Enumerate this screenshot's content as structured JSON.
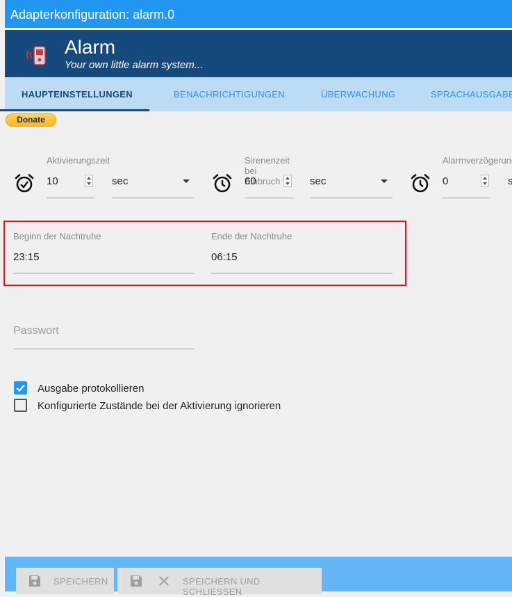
{
  "window": {
    "title": "Adapterkonfiguration: alarm.0"
  },
  "header": {
    "title": "Alarm",
    "subtitle": "Your own little alarm system..."
  },
  "tabs": [
    {
      "label": "HAUPTEINSTELLUNGEN",
      "active": true
    },
    {
      "label": "BENACHRICHTIGUNGEN",
      "active": false
    },
    {
      "label": "ÜBERWACHUNG",
      "active": false
    },
    {
      "label": "SPRACHAUSGABE",
      "active": false
    }
  ],
  "donate": {
    "label": "Donate"
  },
  "timers": [
    {
      "label": "Aktivierungszeit",
      "value": "10",
      "unit": "sec",
      "icon": "alarm-check-icon"
    },
    {
      "label": "Sirenenzeit bei Einbruch",
      "value": "60",
      "unit": "sec",
      "icon": "alarm-clock-icon"
    },
    {
      "label": "Alarmverzögerung",
      "value": "0",
      "unit": "sec",
      "icon": "alarm-clock-icon"
    }
  ],
  "night": {
    "start_label": "Beginn der Nachtruhe",
    "start_value": "23:15",
    "end_label": "Ende der Nachtruhe",
    "end_value": "06:15"
  },
  "password": {
    "placeholder": "Passwort"
  },
  "checkboxes": [
    {
      "label": "Ausgabe protokollieren",
      "checked": true
    },
    {
      "label": "Konfigurierte Zustände bei der Aktivierung ignorieren",
      "checked": false
    }
  ],
  "footer": {
    "save_label": "SPEICHERN",
    "save_close_label": "SPEICHERN UND SCHLIESSEN"
  },
  "colors": {
    "primary": "#2196f3",
    "header": "#174a7c",
    "tabs_bg": "#bcdcf6",
    "footer": "#64b5f6",
    "highlight": "#e0141e"
  }
}
